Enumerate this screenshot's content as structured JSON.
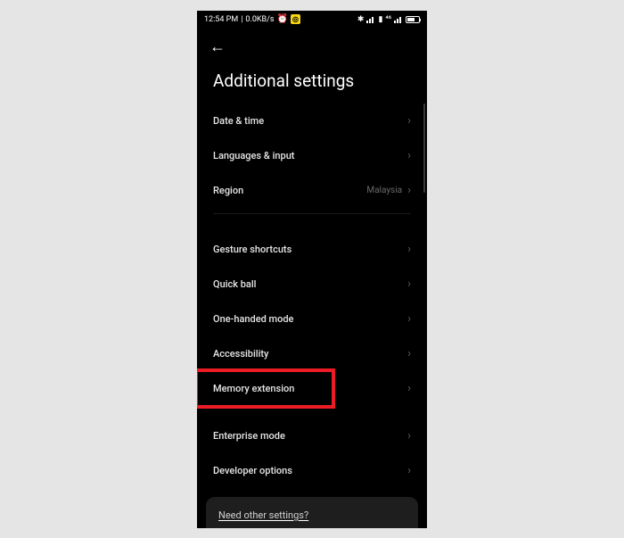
{
  "statusBar": {
    "time": "12:54 PM",
    "netSpeed": "0.0KB/s",
    "alarmGlyph": "⏰",
    "yellowBadgeGlyph": "◎",
    "bluetoothGlyph": "✱",
    "signalGlyph1": "▮",
    "signalText": "⁴⁶",
    "batteryPct": "80"
  },
  "header": {
    "backGlyph": "←",
    "title": "Additional settings"
  },
  "rows": {
    "dateTime": "Date & time",
    "languages": "Languages & input",
    "region": "Region",
    "regionValue": "Malaysia",
    "gesture": "Gesture shortcuts",
    "quickBall": "Quick ball",
    "oneHanded": "One-handed mode",
    "accessibility": "Accessibility",
    "memoryExt": "Memory extension",
    "enterprise": "Enterprise mode",
    "developer": "Developer options"
  },
  "bottomCard": {
    "text": "Need other settings?"
  },
  "chevronGlyph": "›"
}
